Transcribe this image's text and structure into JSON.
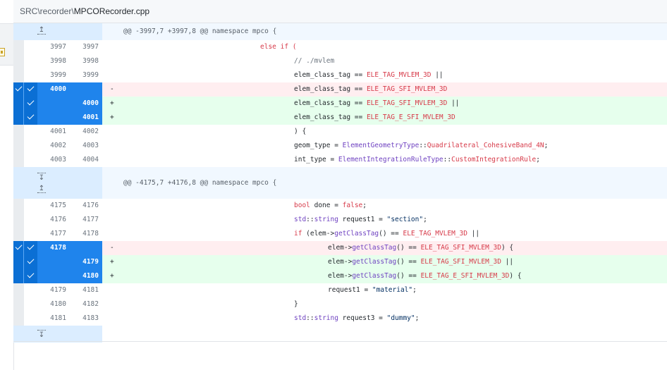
{
  "file_header": {
    "path_prefix": "SRC\\recorder\\",
    "file_name": "MPCORecorder.cpp"
  },
  "hunks": [
    {
      "header": "@@ -3997,7 +3997,8 @@ namespace mpco {"
    },
    {
      "header": "@@ -4175,7 +4176,8 @@ namespace mpco {"
    }
  ],
  "lines": {
    "l3997": {
      "old": "3997",
      "new": "3997",
      "sign": "",
      "text": "else if ("
    },
    "l3998": {
      "old": "3998",
      "new": "3998",
      "sign": "",
      "text": "// ./mvlem"
    },
    "l3999": {
      "old": "3999",
      "new": "3999",
      "sign": "",
      "text": "elem_class_tag == ELE_TAG_MVLEM_3D ||"
    },
    "d4000": {
      "old": "4000",
      "new": "",
      "sign": "-",
      "text": "elem_class_tag == ELE_TAG_SFI_MVLEM_3D"
    },
    "a4000": {
      "old": "",
      "new": "4000",
      "sign": "+",
      "text": "elem_class_tag == ELE_TAG_SFI_MVLEM_3D ||"
    },
    "a4001": {
      "old": "",
      "new": "4001",
      "sign": "+",
      "text": "elem_class_tag == ELE_TAG_E_SFI_MVLEM_3D"
    },
    "l4001": {
      "old": "4001",
      "new": "4002",
      "sign": "",
      "text": ") {"
    },
    "l4002": {
      "old": "4002",
      "new": "4003",
      "sign": "",
      "text": "geom_type = ElementGeometryType::Quadrilateral_CohesiveBand_4N;"
    },
    "l4003": {
      "old": "4003",
      "new": "4004",
      "sign": "",
      "text": "int_type = ElementIntegrationRuleType::CustomIntegrationRule;"
    },
    "l4175": {
      "old": "4175",
      "new": "4176",
      "sign": "",
      "text": "bool done = false;"
    },
    "l4176": {
      "old": "4176",
      "new": "4177",
      "sign": "",
      "text": "std::string request1 = \"section\";"
    },
    "l4177": {
      "old": "4177",
      "new": "4178",
      "sign": "",
      "text": "if (elem->getClassTag() == ELE_TAG_MVLEM_3D ||"
    },
    "d4178": {
      "old": "4178",
      "new": "",
      "sign": "-",
      "text": "elem->getClassTag() == ELE_TAG_SFI_MVLEM_3D) {"
    },
    "a4179": {
      "old": "",
      "new": "4179",
      "sign": "+",
      "text": "elem->getClassTag() == ELE_TAG_SFI_MVLEM_3D ||"
    },
    "a4180": {
      "old": "",
      "new": "4180",
      "sign": "+",
      "text": "elem->getClassTag() == ELE_TAG_E_SFI_MVLEM_3D) {"
    },
    "l4179": {
      "old": "4179",
      "new": "4181",
      "sign": "",
      "text": "request1 = \"material\";"
    },
    "l4180": {
      "old": "4180",
      "new": "4182",
      "sign": "",
      "text": "}"
    },
    "l4181": {
      "old": "4181",
      "new": "4183",
      "sign": "",
      "text": "std::string request3 = \"dummy\";"
    }
  },
  "icons": {
    "expand_up": "↥",
    "expand_down": "↧"
  },
  "colors": {
    "selected_gutter": "#1f84ec",
    "deleted_bg": "#ffeef0",
    "added_bg": "#e6ffed",
    "hunk_bg": "#f1f8ff"
  }
}
